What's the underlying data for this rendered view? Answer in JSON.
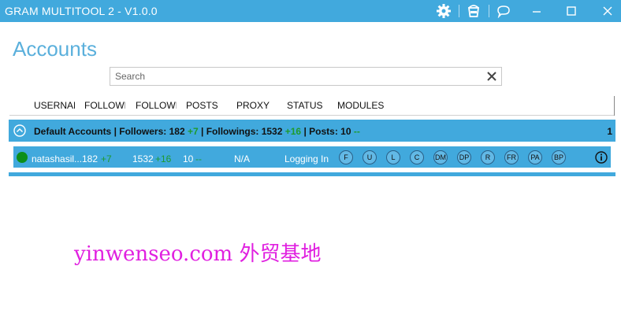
{
  "window": {
    "title": "GRAM MULTITOOL 2 - V1.0.0",
    "icons": [
      "gear-icon",
      "bucket-icon",
      "chat-icon",
      "minimize-icon",
      "maximize-icon",
      "close-icon"
    ]
  },
  "page": {
    "title": "Accounts"
  },
  "search": {
    "placeholder": "Search",
    "value": ""
  },
  "columns": [
    "USERNAME",
    "FOLLOWERS",
    "FOLLOWINGS",
    "POSTS",
    "PROXY",
    "STATUS",
    "MODULES"
  ],
  "group": {
    "name": "Default Accounts",
    "followers_label": "| Followers: 182",
    "followers_delta": "+7",
    "followings_label": "| Followings: 1532",
    "followings_delta": "+16",
    "posts_label": "| Posts: 10",
    "posts_delta": "--",
    "count": "1"
  },
  "accounts": [
    {
      "username": "natashasil...",
      "followers": "182",
      "followers_delta": "+7",
      "followings": "1532",
      "followings_delta": "+16",
      "posts": "10",
      "posts_delta": "--",
      "proxy": "N/A",
      "status": "Logging In",
      "status_color": "#0c8f1a",
      "modules": [
        "F",
        "U",
        "L",
        "C",
        "DM",
        "DP",
        "R",
        "FR",
        "PA",
        "BP"
      ]
    }
  ],
  "watermark": "yinwenseo.com 外贸基地"
}
